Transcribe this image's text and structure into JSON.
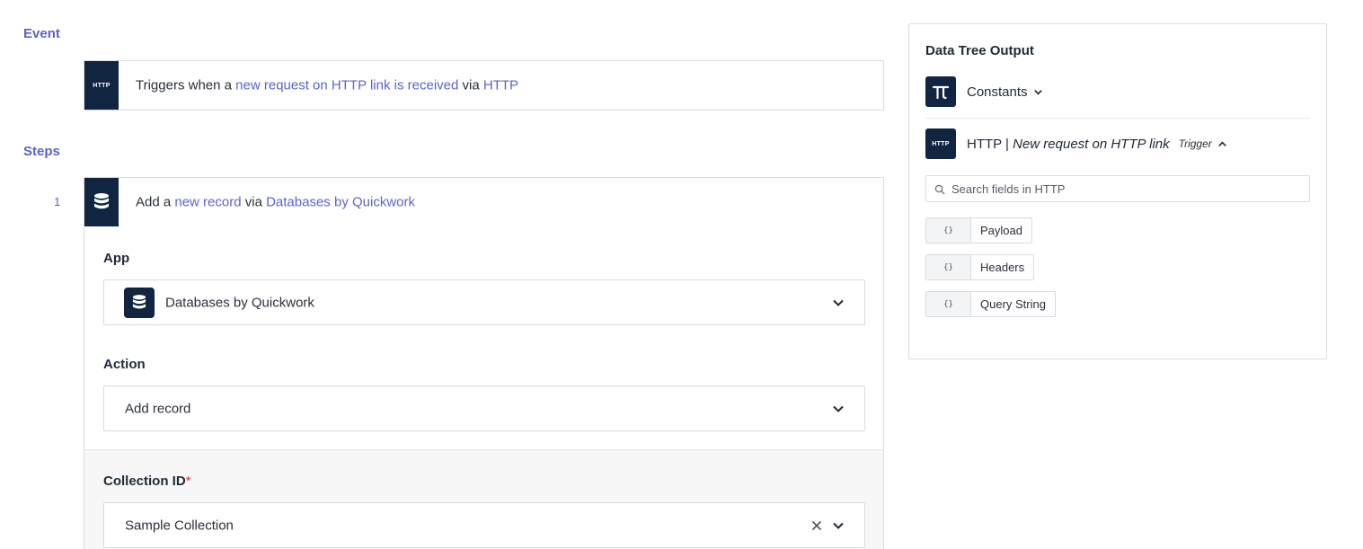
{
  "event": {
    "section_title": "Event",
    "badge": "HTTP",
    "text_prefix": "Triggers when a ",
    "text_link1": "new request on HTTP link is received",
    "text_mid": " via ",
    "text_link2": "HTTP"
  },
  "steps": {
    "section_title": "Steps",
    "step_number": "1",
    "text_prefix": "Add a ",
    "text_link1": "new record",
    "text_mid": " via ",
    "text_link2": "Databases by Quickwork",
    "app_label": "App",
    "app_value": "Databases by Quickwork",
    "action_label": "Action",
    "action_value": "Add record",
    "collection_label": "Collection ID",
    "collection_required": "*",
    "collection_value": "Sample Collection"
  },
  "data_tree": {
    "title": "Data Tree Output",
    "constants_label": "Constants",
    "http_label_prefix": "HTTP | ",
    "http_label_italic": "New request on HTTP link",
    "http_badge": "HTTP",
    "trigger_label": "Trigger",
    "search_placeholder": "Search fields in HTTP",
    "fields": [
      {
        "type": "{}",
        "name": "Payload"
      },
      {
        "type": "{}",
        "name": "Headers"
      },
      {
        "type": "{}",
        "name": "Query String"
      }
    ]
  },
  "colors": {
    "accent": "#5a63c9",
    "badge_bg": "#0f2540",
    "required": "#e53935"
  }
}
